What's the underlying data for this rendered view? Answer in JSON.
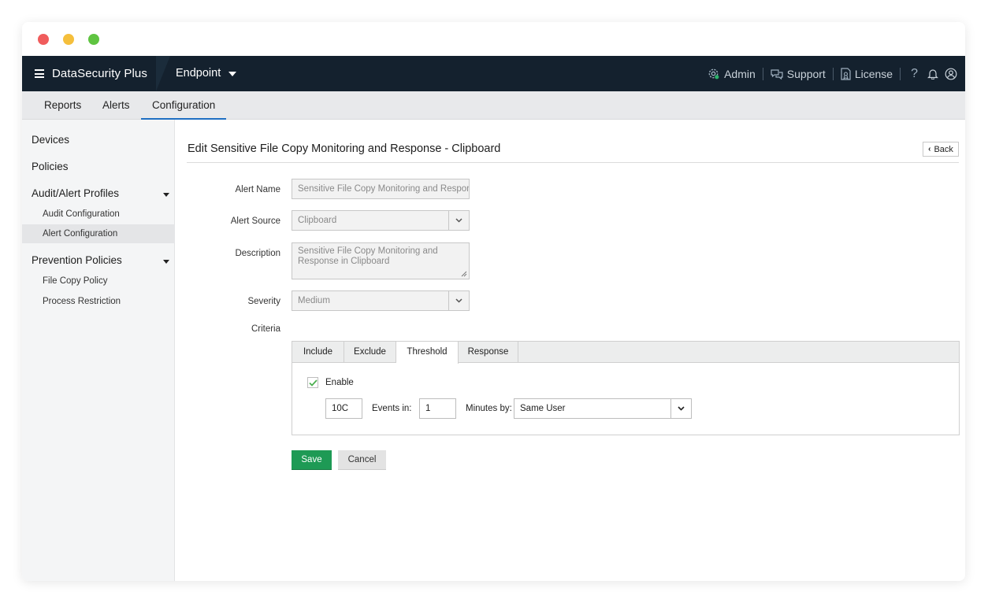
{
  "colors": {
    "traffic_red": "#f05c5c",
    "traffic_yellow": "#f5bf3c",
    "traffic_green": "#5fc441",
    "topbar_bg": "#14212e",
    "active_tab_underline": "#1f6fc2",
    "save_bg": "#1e9a55"
  },
  "topbar": {
    "app_name": "DataSecurity Plus",
    "module": "Endpoint",
    "admin_label": "Admin",
    "support_label": "Support",
    "license_label": "License",
    "help_glyph": "?"
  },
  "tabs": [
    {
      "label": "Reports"
    },
    {
      "label": "Alerts"
    },
    {
      "label": "Configuration"
    }
  ],
  "sidebar": {
    "devices": "Devices",
    "policies": "Policies",
    "audit_alert_profiles": "Audit/Alert Profiles",
    "audit_configuration": "Audit Configuration",
    "alert_configuration": "Alert Configuration",
    "prevention_policies": "Prevention Policies",
    "file_copy_policy": "File Copy Policy",
    "process_restriction": "Process Restriction"
  },
  "page": {
    "title": "Edit Sensitive File Copy Monitoring and Response - Clipboard",
    "back_label": "Back"
  },
  "form": {
    "alert_name_label": "Alert Name",
    "alert_name_value": "Sensitive File Copy Monitoring and Respon",
    "alert_source_label": "Alert Source",
    "alert_source_value": "Clipboard",
    "description_label": "Description",
    "description_value": "Sensitive File Copy Monitoring and Response in Clipboard",
    "severity_label": "Severity",
    "severity_value": "Medium",
    "criteria_label": "Criteria"
  },
  "criteria": {
    "tabs": [
      {
        "label": "Include"
      },
      {
        "label": "Exclude"
      },
      {
        "label": "Threshold"
      },
      {
        "label": "Response"
      }
    ],
    "enable_label": "Enable",
    "events_count": "10C",
    "events_in_label": "Events in:",
    "minutes_value": "1",
    "minutes_by_label": "Minutes by:",
    "group_by_value": "Same User"
  },
  "actions": {
    "save_label": "Save",
    "cancel_label": "Cancel"
  }
}
